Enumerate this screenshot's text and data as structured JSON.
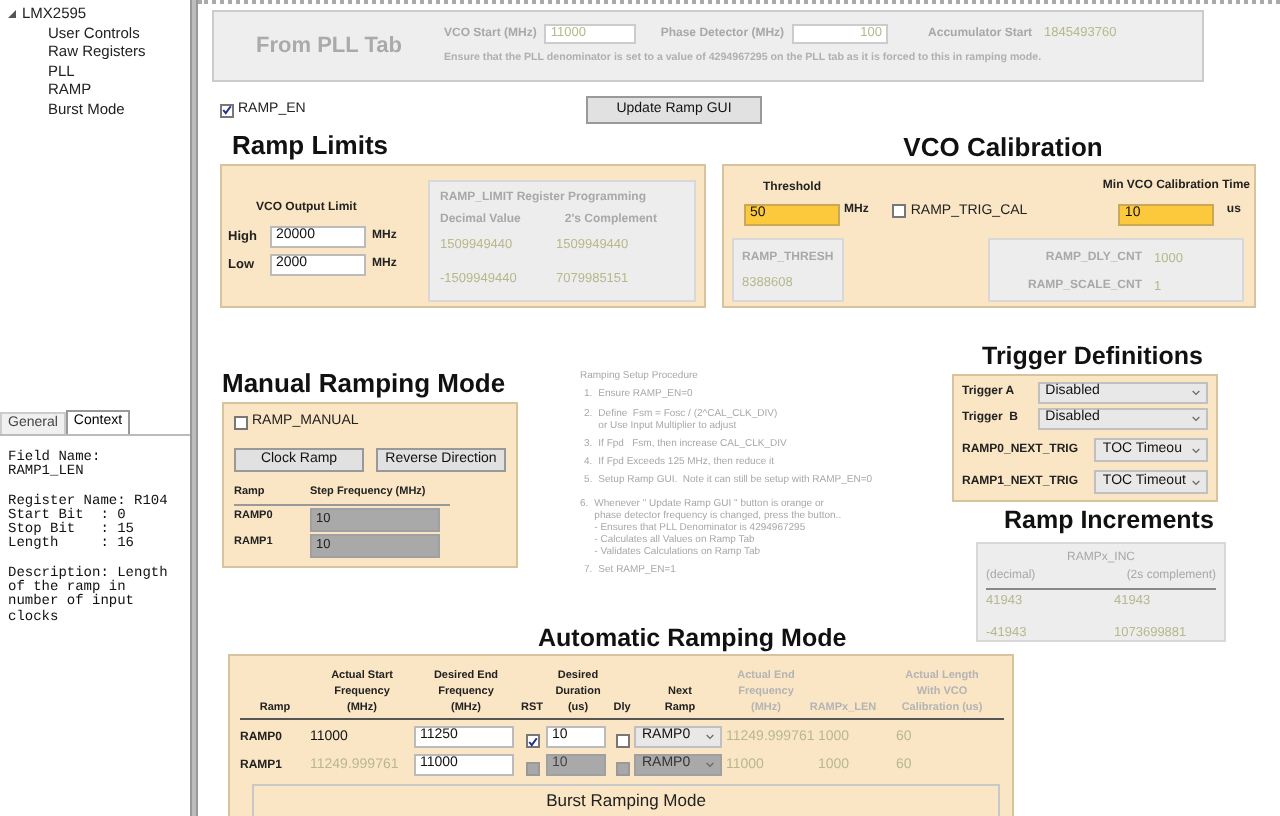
{
  "tree": {
    "label": "LMX2595",
    "expanded": true,
    "children": [
      {
        "label": "User Controls",
        "selected": false
      },
      {
        "label": "Raw Registers",
        "selected": false
      },
      {
        "label": "PLL",
        "selected": false
      },
      {
        "label": "RAMP",
        "selected": false
      },
      {
        "label": "Burst Mode",
        "selected": false
      }
    ]
  },
  "context_tabs": [
    {
      "label": "General",
      "selected": false
    },
    {
      "label": "Context",
      "selected": true
    }
  ],
  "context_text": [
    "Field Name:\nRAMP1_LEN",
    "Register Name: R104\nStart Bit  : 0\nStop Bit   : 15\nLength     : 16",
    "Description: Length\nof the ramp in\nnumber of input\nclocks"
  ],
  "pll_tab": {
    "title": "From PLL Tab",
    "vco_start_label": "VCO Start (MHz)",
    "vco_start_value": "11000",
    "phase_detector_label": "Phase Detector (MHz)",
    "phase_detector_value": "100",
    "accumulator_label": "Accumulator Start",
    "accumulator_value": "1845493760",
    "note": "Ensure that the PLL denominator is set to a value of 4294967295 on the PLL tab as it is forced to this in ramping mode."
  },
  "ramp_en": {
    "label": "RAMP_EN",
    "checked": true
  },
  "update_button": "Update Ramp GUI",
  "ramp_limits": {
    "title": "Ramp Limits",
    "vco_output_limit_label": "VCO Output Limit",
    "limits": [
      {
        "label": "High",
        "value": "20000",
        "unit": "MHz"
      },
      {
        "label": "Low",
        "value": "2000",
        "unit": "MHz"
      }
    ],
    "register": {
      "title": "RAMP_LIMIT Register Programming",
      "columns": [
        "Decimal Value",
        "2's Complement"
      ],
      "rows": [
        [
          "1509949440",
          "1509949440"
        ],
        [
          "-1509949440",
          "7079985151"
        ]
      ]
    }
  },
  "vco_calibration": {
    "title": "VCO Calibration",
    "threshold_label": "Threshold",
    "threshold_value": "50",
    "threshold_unit": "MHz",
    "ramp_trig_cal": {
      "label": "RAMP_TRIG_CAL",
      "checked": false
    },
    "min_time_label": "Min VCO Calibration Time",
    "min_time_value": "10",
    "min_time_unit": "us",
    "ramp_thresh_label": "RAMP_THRESH",
    "ramp_thresh_value": "8388608",
    "counts": [
      {
        "label": "RAMP_DLY_CNT",
        "value": "1000"
      },
      {
        "label": "RAMP_SCALE_CNT",
        "value": "1"
      }
    ]
  },
  "manual": {
    "title": "Manual Ramping Mode",
    "ramp_manual": {
      "label": "RAMP_MANUAL",
      "checked": false
    },
    "buttons": [
      "Clock Ramp",
      "Reverse Direction"
    ],
    "columns": [
      "Ramp",
      "Step Frequency (MHz)"
    ],
    "rows": [
      {
        "ramp": "RAMP0",
        "step": "10"
      },
      {
        "ramp": "RAMP1",
        "step": "10"
      }
    ]
  },
  "procedure": {
    "title": "Ramping Setup Procedure",
    "steps": [
      {
        "number": "1.",
        "text": "Ensure RAMP_EN=0"
      },
      {
        "number": "2.",
        "text": "Define  Fsm = Fosc / (2^CAL_CLK_DIV)\nor Use Input Multiplier to adjust"
      },
      {
        "number": "3.",
        "text": "If Fpd   Fsm, then increase CAL_CLK_DIV"
      },
      {
        "number": "4.",
        "text": "If Fpd Exceeds 125 MHz, then reduce it"
      },
      {
        "number": "5.",
        "text": "Setup Ramp GUI.  Note it can still be setup with RAMP_EN=0"
      },
      {
        "number": "6.",
        "text": "Whenever \" Update Ramp GUI \" button is orange or\nphase detector frequency is changed, press the button..\n- Ensures that PLL Denominator is 4294967295\n- Calculates all Values on Ramp Tab\n- Validates Calculations on Ramp Tab"
      },
      {
        "number": "7.",
        "text": "Set RAMP_EN=1"
      }
    ]
  },
  "trigger": {
    "title": "Trigger Definitions",
    "rows": [
      {
        "kind": "short",
        "label": "Trigger A",
        "value": "Disabled"
      },
      {
        "kind": "short",
        "label": "Trigger  B",
        "value": "Disabled"
      },
      {
        "kind": "long",
        "label": "RAMP0_NEXT_TRIG",
        "value": "TOC Timeou"
      },
      {
        "kind": "long",
        "label": "RAMP1_NEXT_TRIG",
        "value": "TOC Timeout"
      }
    ]
  },
  "increments": {
    "title": "Ramp Increments",
    "header": "RAMPx_INC",
    "columns": [
      "(decimal)",
      "(2s complement)"
    ],
    "rows": [
      [
        "41943",
        "41943"
      ],
      [
        "-41943",
        "1073699881"
      ]
    ]
  },
  "auto": {
    "title": "Automatic Ramping Mode",
    "columns": [
      {
        "label": "Ramp",
        "kind": "input"
      },
      {
        "label": "Actual Start\nFrequency\n(MHz)",
        "kind": "input"
      },
      {
        "label": "Desired End\nFrequency\n(MHz)",
        "kind": "input"
      },
      {
        "label": "RST",
        "kind": "input"
      },
      {
        "label": "Desired\nDuration\n(us)",
        "kind": "input"
      },
      {
        "label": "Dly",
        "kind": "input"
      },
      {
        "label": "Next\nRamp",
        "kind": "input"
      },
      {
        "label": "Actual End\nFrequency\n(MHz)",
        "kind": "computed"
      },
      {
        "label": "RAMPx_LEN",
        "kind": "computed"
      },
      {
        "label": "Actual Length\nWith VCO\nCalibration (us)",
        "kind": "computed"
      }
    ],
    "rows": [
      {
        "ramp": "RAMP0",
        "disabled": false,
        "start": "11000",
        "end": "11250",
        "rst": {
          "checked": true
        },
        "duration": "10",
        "dly": {
          "checked": false
        },
        "next": "RAMP0",
        "actual_end": "11249.999761",
        "len": "1000",
        "actual_length": "60"
      },
      {
        "ramp": "RAMP1",
        "disabled": true,
        "start": "11249.999761",
        "end": "11000",
        "rst": {
          "checked": false
        },
        "duration": "10",
        "dly": {
          "checked": false
        },
        "next": "RAMP0",
        "actual_end": "11000",
        "len": "1000",
        "actual_length": "60"
      }
    ]
  },
  "burst_title": "Burst Ramping Mode"
}
